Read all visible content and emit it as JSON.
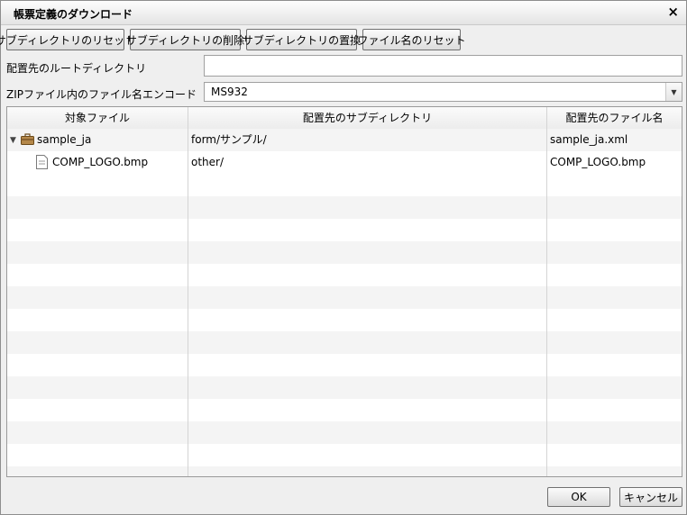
{
  "dialog": {
    "title": "帳票定義のダウンロード",
    "close_icon": "×"
  },
  "toolbar": {
    "reset_subdir_label": "サブディレクトリのリセット",
    "delete_subdir_label": "サブディレクトリの削除",
    "replace_subdir_label": "サブディレクトリの置換",
    "reset_filename_label": "ファイル名のリセット"
  },
  "form": {
    "root_dir_label": "配置先のルートディレクトリ",
    "root_dir_value": "",
    "encoding_label": "ZIPファイル内のファイル名エンコード",
    "encoding_value": "MS932"
  },
  "table": {
    "headers": [
      "対象ファイル",
      "配置先のサブディレクトリ",
      "配置先のファイル名"
    ],
    "rows": [
      {
        "file": "sample_ja",
        "subdir": "form/サンプル/",
        "filename": "sample_ja.xml",
        "icon": "folder-icon",
        "expanded": true
      },
      {
        "file": "COMP_LOGO.bmp",
        "subdir": "other/",
        "filename": "COMP_LOGO.bmp",
        "icon": "file-icon"
      }
    ]
  },
  "footer": {
    "ok_label": "OK",
    "cancel_label": "キャンセル"
  }
}
